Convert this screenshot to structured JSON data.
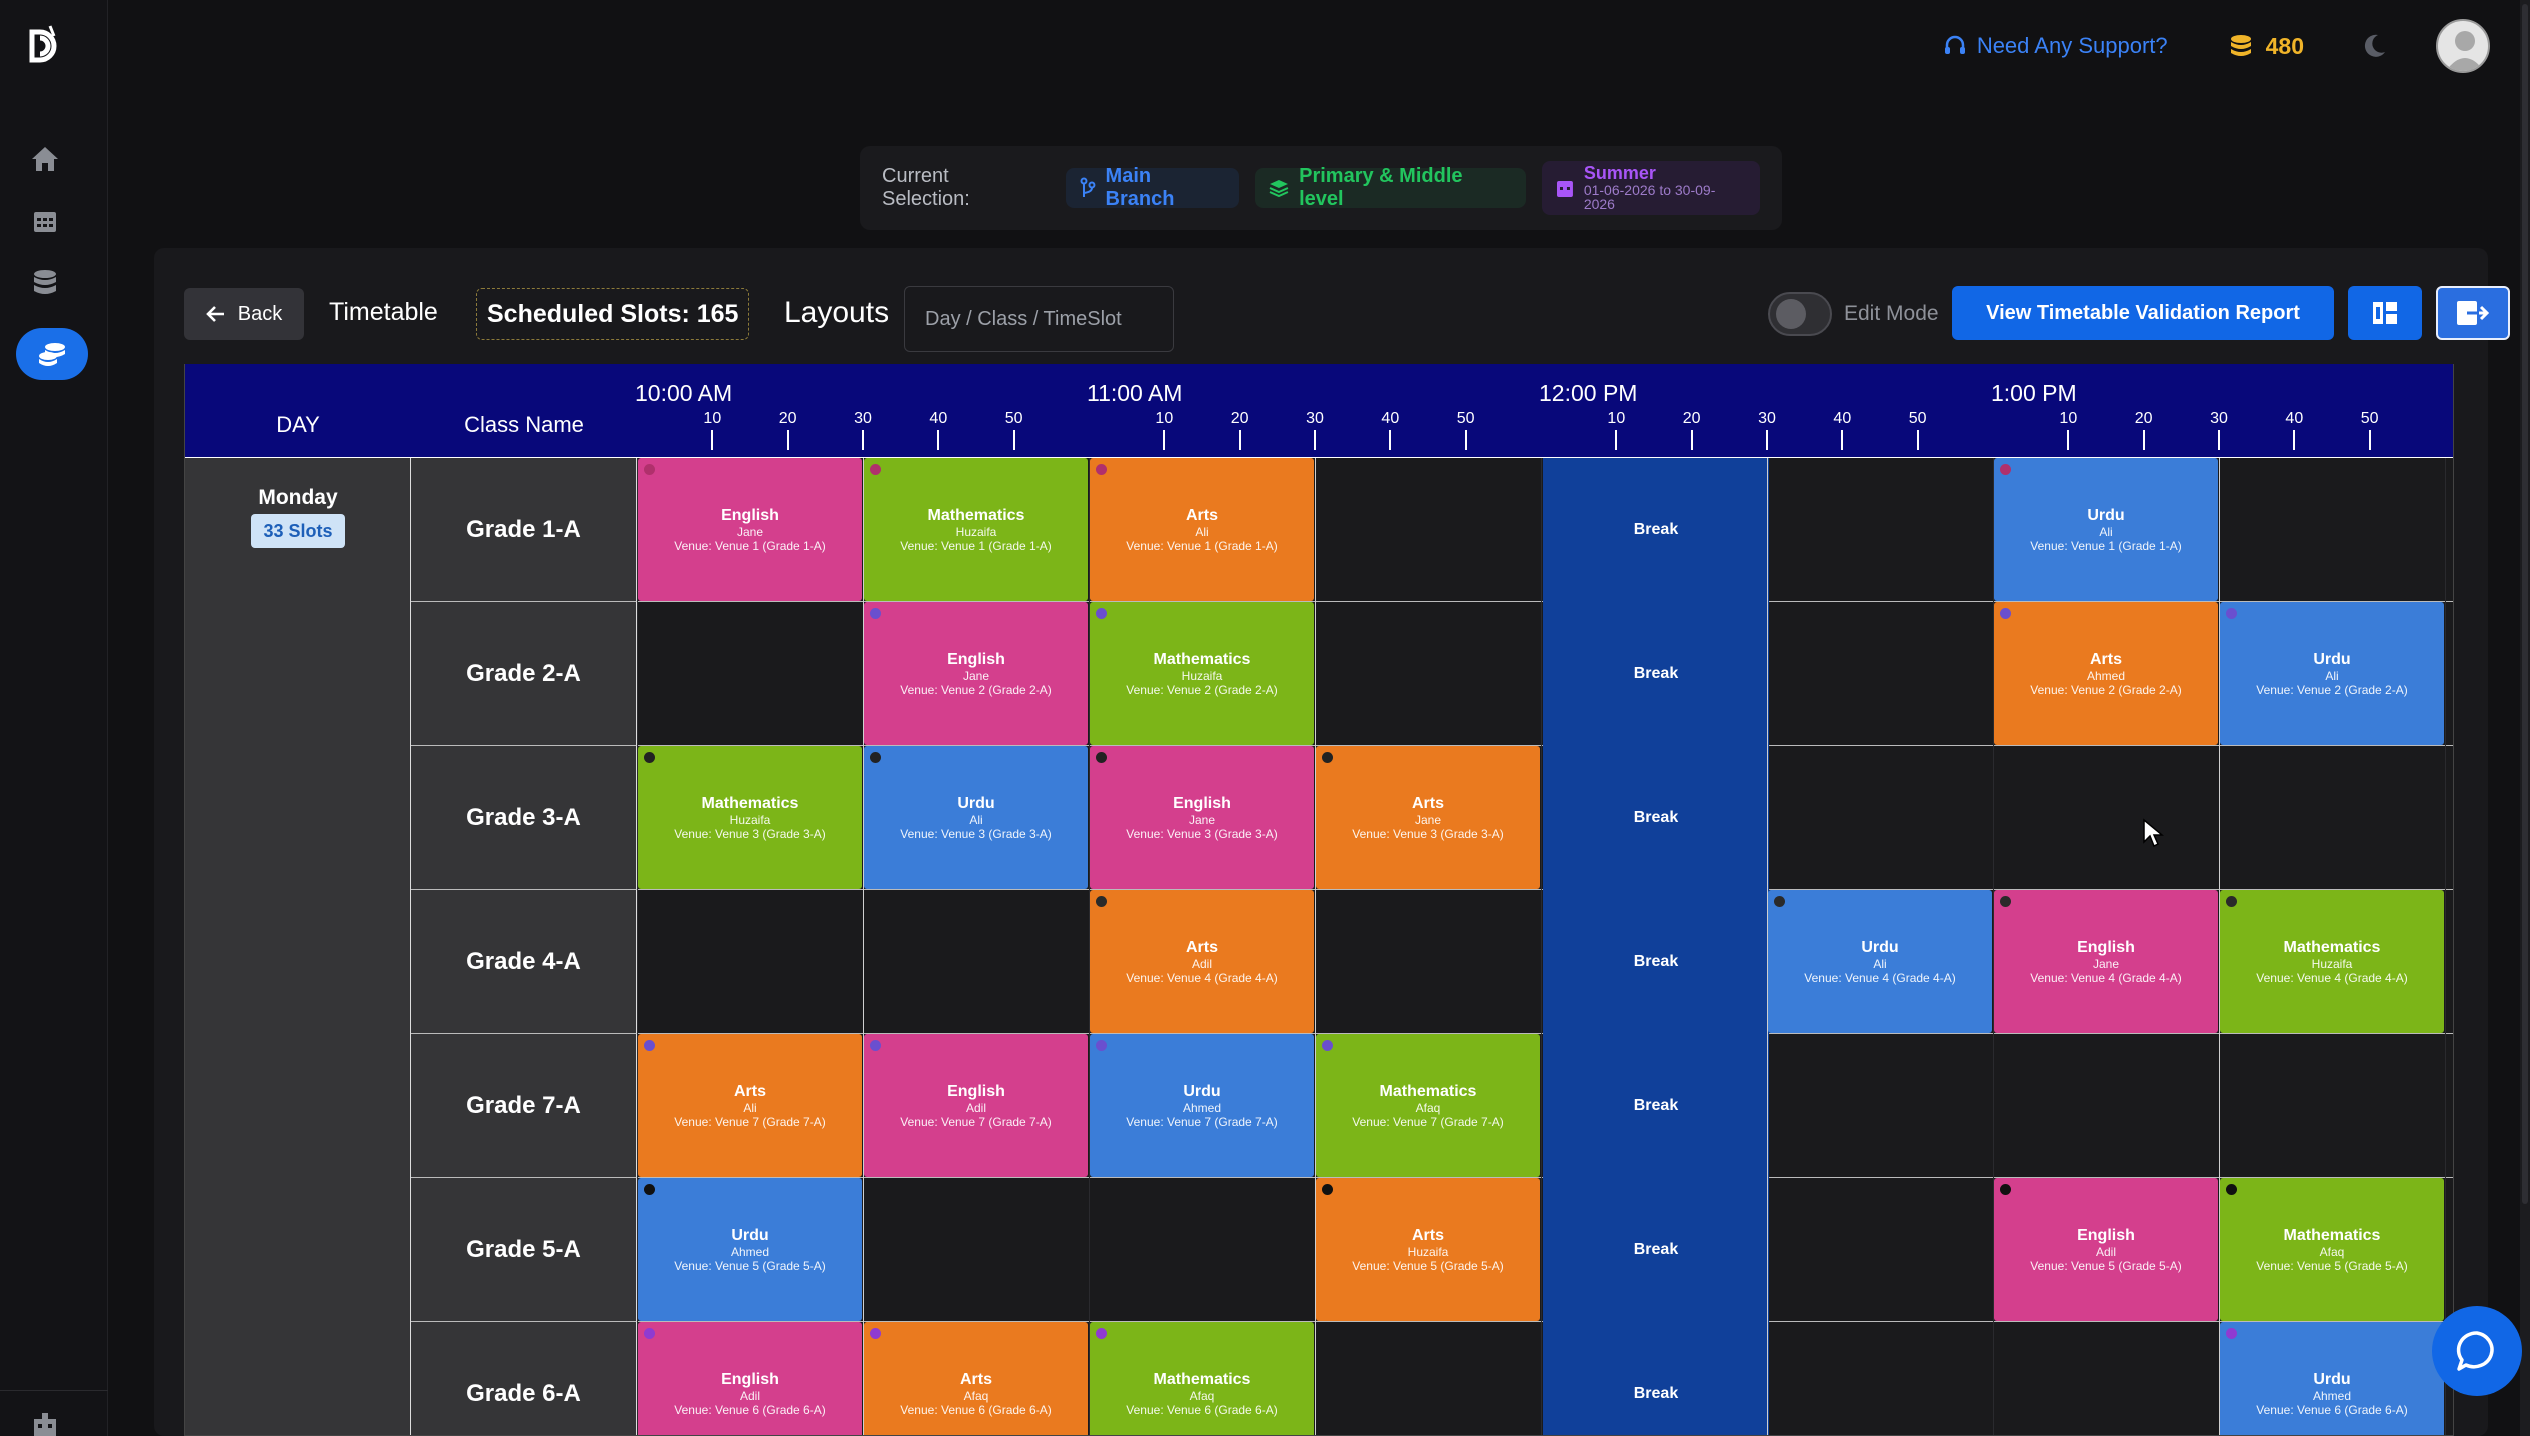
{
  "topbar": {
    "support_label": "Need Any Support?",
    "coins": "480"
  },
  "selection": {
    "label": "Current Selection:",
    "branch": "Main Branch",
    "level": "Primary & Middle level",
    "term_name": "Summer",
    "term_dates": "01-06-2026 to 30-09-2026"
  },
  "toolbar": {
    "back_label": "Back",
    "title": "Timetable",
    "scheduled_slots": "Scheduled Slots: 165",
    "layouts_label": "Layouts",
    "layout_value": "Day / Class / TimeSlot",
    "edit_mode_label": "Edit Mode",
    "validation_label": "View Timetable Validation Report"
  },
  "timetable": {
    "day_header": "DAY",
    "class_header": "Class Name",
    "hours": [
      "10:00 AM",
      "11:00 AM",
      "12:00 PM",
      "1:00 PM"
    ],
    "tick_labels": [
      "10",
      "20",
      "30",
      "40",
      "50"
    ],
    "day": "Monday",
    "day_slots": "33 Slots",
    "break_label": "Break",
    "classes": [
      "Grade 1-A",
      "Grade 2-A",
      "Grade 3-A",
      "Grade 4-A",
      "Grade 7-A",
      "Grade 5-A",
      "Grade 6-A"
    ],
    "colors": {
      "English": "#d43f8d",
      "Mathematics": "#7cb518",
      "Arts": "#ea7a1f",
      "Urdu": "#3b7dd8",
      "Break": "#10409a",
      "Header": "#08087a"
    },
    "lessons": [
      [
        {
          "slot": 0,
          "subject": "English",
          "teacher": "Jane",
          "venue": "Venue: Venue 1 (Grade 1-A)"
        },
        {
          "slot": 1,
          "subject": "Mathematics",
          "teacher": "Huzaifa",
          "venue": "Venue: Venue 1 (Grade 1-A)"
        },
        {
          "slot": 2,
          "subject": "Arts",
          "teacher": "Ali",
          "venue": "Venue: Venue 1 (Grade 1-A)"
        },
        {
          "slot": 6,
          "subject": "Urdu",
          "teacher": "Ali",
          "venue": "Venue: Venue 1 (Grade 1-A)"
        }
      ],
      [
        {
          "slot": 1,
          "subject": "English",
          "teacher": "Jane",
          "venue": "Venue: Venue 2 (Grade 2-A)"
        },
        {
          "slot": 2,
          "subject": "Mathematics",
          "teacher": "Huzaifa",
          "venue": "Venue: Venue 2 (Grade 2-A)"
        },
        {
          "slot": 6,
          "subject": "Arts",
          "teacher": "Ahmed",
          "venue": "Venue: Venue 2 (Grade 2-A)"
        },
        {
          "slot": 7,
          "subject": "Urdu",
          "teacher": "Ali",
          "venue": "Venue: Venue 2 (Grade 2-A)"
        }
      ],
      [
        {
          "slot": 0,
          "subject": "Mathematics",
          "teacher": "Huzaifa",
          "venue": "Venue: Venue 3 (Grade 3-A)"
        },
        {
          "slot": 1,
          "subject": "Urdu",
          "teacher": "Ali",
          "venue": "Venue: Venue 3 (Grade 3-A)"
        },
        {
          "slot": 2,
          "subject": "English",
          "teacher": "Jane",
          "venue": "Venue: Venue 3 (Grade 3-A)"
        },
        {
          "slot": 3,
          "subject": "Arts",
          "teacher": "Jane",
          "venue": "Venue: Venue 3 (Grade 3-A)"
        }
      ],
      [
        {
          "slot": 2,
          "subject": "Arts",
          "teacher": "Adil",
          "venue": "Venue: Venue 4 (Grade 4-A)"
        },
        {
          "slot": 5,
          "subject": "Urdu",
          "teacher": "Ali",
          "venue": "Venue: Venue 4 (Grade 4-A)"
        },
        {
          "slot": 6,
          "subject": "English",
          "teacher": "Jane",
          "venue": "Venue: Venue 4 (Grade 4-A)"
        },
        {
          "slot": 7,
          "subject": "Mathematics",
          "teacher": "Huzaifa",
          "venue": "Venue: Venue 4 (Grade 4-A)"
        }
      ],
      [
        {
          "slot": 0,
          "subject": "Arts",
          "teacher": "Ali",
          "venue": "Venue: Venue 7 (Grade 7-A)"
        },
        {
          "slot": 1,
          "subject": "English",
          "teacher": "Adil",
          "venue": "Venue: Venue 7 (Grade 7-A)"
        },
        {
          "slot": 2,
          "subject": "Urdu",
          "teacher": "Ahmed",
          "venue": "Venue: Venue 7 (Grade 7-A)"
        },
        {
          "slot": 3,
          "subject": "Mathematics",
          "teacher": "Afaq",
          "venue": "Venue: Venue 7 (Grade 7-A)"
        }
      ],
      [
        {
          "slot": 0,
          "subject": "Urdu",
          "teacher": "Ahmed",
          "venue": "Venue: Venue 5 (Grade 5-A)"
        },
        {
          "slot": 3,
          "subject": "Arts",
          "teacher": "Huzaifa",
          "venue": "Venue: Venue 5 (Grade 5-A)"
        },
        {
          "slot": 6,
          "subject": "English",
          "teacher": "Adil",
          "venue": "Venue: Venue 5 (Grade 5-A)"
        },
        {
          "slot": 7,
          "subject": "Mathematics",
          "teacher": "Afaq",
          "venue": "Venue: Venue 5 (Grade 5-A)"
        }
      ],
      [
        {
          "slot": 0,
          "subject": "English",
          "teacher": "Adil",
          "venue": "Venue: Venue 6 (Grade 6-A)"
        },
        {
          "slot": 1,
          "subject": "Arts",
          "teacher": "Afaq",
          "venue": "Venue: Venue 6 (Grade 6-A)"
        },
        {
          "slot": 2,
          "subject": "Mathematics",
          "teacher": "Afaq",
          "venue": "Venue: Venue 6 (Grade 6-A)"
        },
        {
          "slot": 7,
          "subject": "Urdu",
          "teacher": "Ahmed",
          "venue": "Venue: Venue 6 (Grade 6-A)"
        }
      ]
    ]
  }
}
